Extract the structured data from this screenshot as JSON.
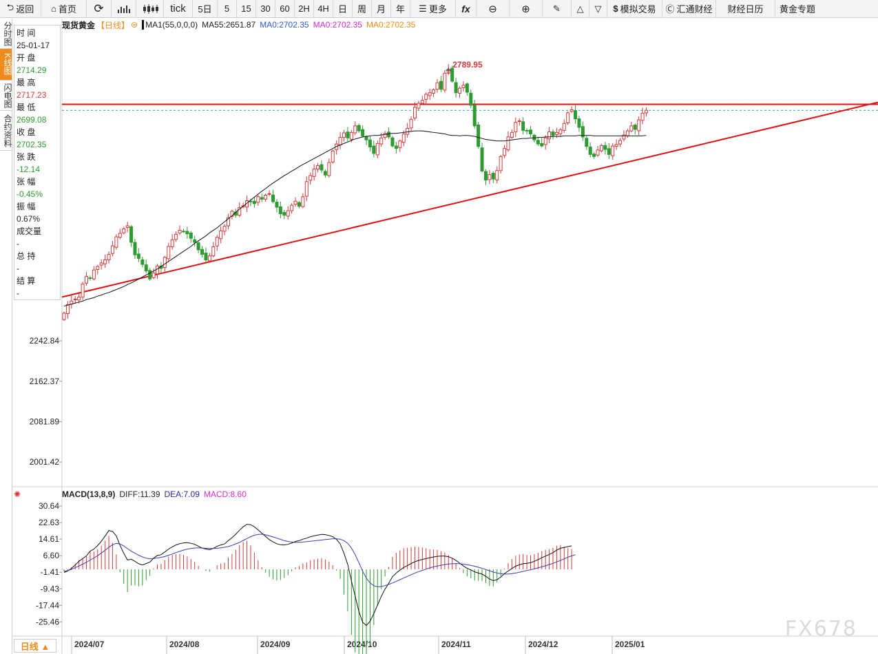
{
  "toolbar": {
    "back": "返回",
    "home": "首页",
    "tick": "tick",
    "d5": "5日",
    "p5": "5",
    "p15": "15",
    "p30": "30",
    "p60": "60",
    "h2": "2H",
    "h4": "4H",
    "day": "日",
    "week": "周",
    "month": "月",
    "year": "年",
    "more": "更多",
    "sim": "模拟交易",
    "huitong": "汇通财经",
    "calendar": "财经日历",
    "gold": "黄金专题"
  },
  "lefttabs": [
    "分时图",
    "K线图",
    "闪电图",
    "合约资料"
  ],
  "info": {
    "time_label": "时 间",
    "time_value": "25-01-17",
    "open_label": "开 盘",
    "open_value": "2714.29",
    "high_label": "最 高",
    "high_value": "2717.23",
    "low_label": "最 低",
    "low_value": "2699.08",
    "close_label": "收 盘",
    "close_value": "2702.35",
    "chg_label": "张 跌",
    "chg_value": "-12.14",
    "pct_label": "张 幅",
    "pct_value": "-0.45%",
    "amp_label": "振 幅",
    "amp_value": "0.67%",
    "vol_label": "成交量",
    "vol_value": "-",
    "oi_label": "总 持",
    "oi_value": "-",
    "settle_label": "结 算",
    "settle_value": "-"
  },
  "legend": {
    "symbol": "现货黄金",
    "period": "【日线】",
    "ma1": "MA1(55,0,0,0)",
    "ma55": "MA55:2651.87",
    "ma0a": "MA0:2702.35",
    "ma0b": "MA0:2702.35",
    "ma0c": "MA0:2702.35"
  },
  "macd_legend": {
    "name": "MACD(13,8,9)",
    "diff": "DIFF:11.39",
    "dea": "DEA:7.09",
    "macd": "MACD:8.60"
  },
  "timeframe_button": "日线 ▲",
  "watermark": "FX678",
  "colors": {
    "up": "#d23a3a",
    "down": "#2e9a32",
    "ma": "#111111",
    "trend": "#e01010",
    "dea": "#3b3bb0",
    "macd_pink": "#d42bd4",
    "orange": "#f08c1e"
  },
  "chart_data": [
    {
      "type": "candlestick",
      "title": "",
      "y_ticks": [
        2242.84,
        2162.37,
        2081.89,
        2001.42
      ],
      "x_labels": [
        "2024/07",
        "2024/08",
        "2024/09",
        "2024/10",
        "2024/11",
        "2024/12",
        "2025/01"
      ],
      "ylim": [
        1955,
        2860
      ],
      "peak_label": "2789.95",
      "resistance": 2714.0,
      "trendline": [
        {
          "date": "2024-06-28",
          "price": 2330
        },
        {
          "date": "2025-02-17",
          "price": 2718
        }
      ],
      "closes": [
        2298,
        2315,
        2322,
        2326,
        2330,
        2356,
        2371,
        2367,
        2384,
        2391,
        2398,
        2404,
        2415,
        2432,
        2450,
        2457,
        2466,
        2472,
        2439,
        2414,
        2407,
        2395,
        2382,
        2366,
        2378,
        2392,
        2387,
        2409,
        2431,
        2444,
        2455,
        2463,
        2461,
        2456,
        2447,
        2439,
        2424,
        2415,
        2404,
        2412,
        2430,
        2449,
        2462,
        2471,
        2488,
        2501,
        2493,
        2508,
        2512,
        2522,
        2520,
        2516,
        2530,
        2525,
        2533,
        2536,
        2520,
        2509,
        2496,
        2493,
        2502,
        2513,
        2521,
        2511,
        2530,
        2560,
        2572,
        2585,
        2592,
        2583,
        2573,
        2598,
        2621,
        2635,
        2648,
        2657,
        2647,
        2658,
        2671,
        2661,
        2651,
        2643,
        2629,
        2616,
        2636,
        2647,
        2656,
        2649,
        2631,
        2626,
        2641,
        2655,
        2666,
        2684,
        2708,
        2716,
        2722,
        2734,
        2737,
        2743,
        2757,
        2744,
        2776,
        2784,
        2760,
        2737,
        2746,
        2752,
        2738,
        2712,
        2671,
        2630,
        2581,
        2563,
        2574,
        2565,
        2582,
        2610,
        2626,
        2649,
        2658,
        2678,
        2681,
        2662,
        2661,
        2655,
        2643,
        2635,
        2631,
        2647,
        2659,
        2652,
        2658,
        2663,
        2676,
        2697,
        2703,
        2685,
        2668,
        2649,
        2630,
        2614,
        2610,
        2623,
        2632,
        2624,
        2614,
        2631,
        2634,
        2642,
        2653,
        2661,
        2671,
        2664,
        2683,
        2696,
        2702
      ],
      "ma55": [
        2312,
        2314,
        2316,
        2318,
        2320,
        2322,
        2325,
        2327,
        2329,
        2332,
        2334,
        2337,
        2339,
        2342,
        2345,
        2348,
        2351,
        2355,
        2358,
        2362,
        2366,
        2370,
        2374,
        2378,
        2382,
        2386,
        2391,
        2396,
        2401,
        2406,
        2411,
        2416,
        2421,
        2426,
        2431,
        2437,
        2442,
        2447,
        2452,
        2458,
        2463,
        2468,
        2474,
        2480,
        2486,
        2492,
        2499,
        2505,
        2511,
        2517,
        2523,
        2529,
        2535,
        2541,
        2546,
        2552,
        2557,
        2562,
        2567,
        2572,
        2576,
        2581,
        2585,
        2590,
        2594,
        2598,
        2602,
        2606,
        2610,
        2614,
        2618,
        2622,
        2626,
        2630,
        2633,
        2636,
        2639,
        2642,
        2645,
        2647,
        2649,
        2650,
        2651,
        2652,
        2652,
        2653,
        2654,
        2655,
        2656,
        2656,
        2657,
        2658,
        2659,
        2660,
        2661,
        2661,
        2661,
        2660,
        2659,
        2658,
        2657,
        2656,
        2655,
        2653,
        2652,
        2652,
        2651,
        2652,
        2652,
        2651,
        2650,
        2648,
        2646,
        2644,
        2643,
        2642,
        2641,
        2641,
        2641,
        2642,
        2643,
        2644,
        2645,
        2646,
        2646,
        2647,
        2647,
        2648,
        2648,
        2649,
        2649,
        2650,
        2650,
        2650,
        2651,
        2651,
        2651,
        2651,
        2652,
        2652,
        2652,
        2652,
        2651,
        2651,
        2651,
        2651,
        2651,
        2651,
        2651,
        2651,
        2651,
        2651,
        2651,
        2651,
        2651,
        2651,
        2652
      ]
    },
    {
      "type": "macd",
      "y_ticks": [
        30.64,
        22.63,
        14.61,
        6.6,
        -1.41,
        -9.43,
        -17.44,
        -25.46
      ],
      "ylim": [
        -31,
        34
      ],
      "diff": [
        -1.5,
        -0.8,
        0.5,
        2.1,
        3.9,
        5.2,
        6.5,
        8.8,
        9.8,
        11.5,
        13.6,
        16.1,
        18.8,
        18.3,
        16.2,
        11.6,
        7.8,
        4.5,
        4.9,
        3.9,
        2.7,
        2.1,
        2.8,
        3.5,
        5.4,
        6.7,
        7.1,
        8.4,
        9.8,
        10.9,
        11.8,
        12.4,
        12.8,
        12.9,
        12.6,
        12.1,
        11.2,
        10.3,
        9.8,
        9.5,
        10.1,
        11.2,
        11.8,
        12.3,
        13.9,
        15.3,
        17.0,
        18.9,
        20.6,
        21.8,
        21.6,
        20.6,
        19.1,
        17.5,
        15.9,
        14.4,
        13.3,
        12.4,
        11.9,
        11.8,
        12.1,
        12.7,
        13.5,
        13.9,
        14.6,
        15.1,
        15.8,
        16.2,
        16.6,
        16.9,
        16.8,
        16.4,
        15.8,
        14.5,
        12.3,
        7.8,
        2.4,
        -5.6,
        -13.0,
        -20.4,
        -25.6,
        -27.2,
        -25.1,
        -21.4,
        -17.3,
        -13.1,
        -9.6,
        -6.7,
        -3.6,
        -1.8,
        -0.4,
        0.9,
        1.8,
        2.8,
        3.7,
        4.3,
        4.8,
        5.2,
        5.6,
        6.0,
        6.3,
        6.4,
        6.4,
        6.1,
        5.4,
        4.3,
        3.0,
        1.6,
        0.5,
        -0.3,
        -1.2,
        -1.8,
        -2.3,
        -3.4,
        -4.7,
        -5.5,
        -5.0,
        -3.8,
        -2.1,
        -0.8,
        0.4,
        1.5,
        2.2,
        2.7,
        2.9,
        3.2,
        3.9,
        4.7,
        5.6,
        6.4,
        7.2,
        8.1,
        9.3,
        10.2,
        10.6,
        11.0,
        11.39
      ],
      "dea": [
        -1.0,
        -0.6,
        0.0,
        0.8,
        1.6,
        2.5,
        3.4,
        4.5,
        5.5,
        6.6,
        7.9,
        9.2,
        10.7,
        11.9,
        12.6,
        12.3,
        11.3,
        10.0,
        8.8,
        7.8,
        6.8,
        6.0,
        5.4,
        5.1,
        5.2,
        5.5,
        5.8,
        6.2,
        6.8,
        7.4,
        8.1,
        8.7,
        9.3,
        9.8,
        10.1,
        10.3,
        10.4,
        10.3,
        10.2,
        10.1,
        10.1,
        10.2,
        10.4,
        10.7,
        11.0,
        11.6,
        12.3,
        13.0,
        14.0,
        14.9,
        15.8,
        16.5,
        16.9,
        17.0,
        16.7,
        16.2,
        15.7,
        15.1,
        14.5,
        13.9,
        13.5,
        13.2,
        13.0,
        13.1,
        13.2,
        13.4,
        13.6,
        13.8,
        14.0,
        14.2,
        14.4,
        14.6,
        14.8,
        14.8,
        14.6,
        13.9,
        12.6,
        10.3,
        7.1,
        3.2,
        -0.9,
        -4.3,
        -6.6,
        -7.9,
        -8.5,
        -8.3,
        -7.9,
        -7.3,
        -6.6,
        -5.8,
        -5.0,
        -4.2,
        -3.4,
        -2.6,
        -1.8,
        -1.1,
        -0.5,
        0.1,
        0.7,
        1.2,
        1.6,
        2.0,
        2.3,
        2.6,
        2.7,
        2.8,
        2.7,
        2.5,
        2.2,
        1.9,
        1.5,
        1.0,
        0.5,
        -0.1,
        -0.7,
        -1.3,
        -1.8,
        -2.1,
        -2.3,
        -2.3,
        -2.1,
        -1.8,
        -1.4,
        -1.0,
        -0.6,
        -0.2,
        0.2,
        0.7,
        1.2,
        1.7,
        2.3,
        2.9,
        3.6,
        4.3,
        5.1,
        5.9,
        6.5,
        7.09
      ]
    }
  ]
}
